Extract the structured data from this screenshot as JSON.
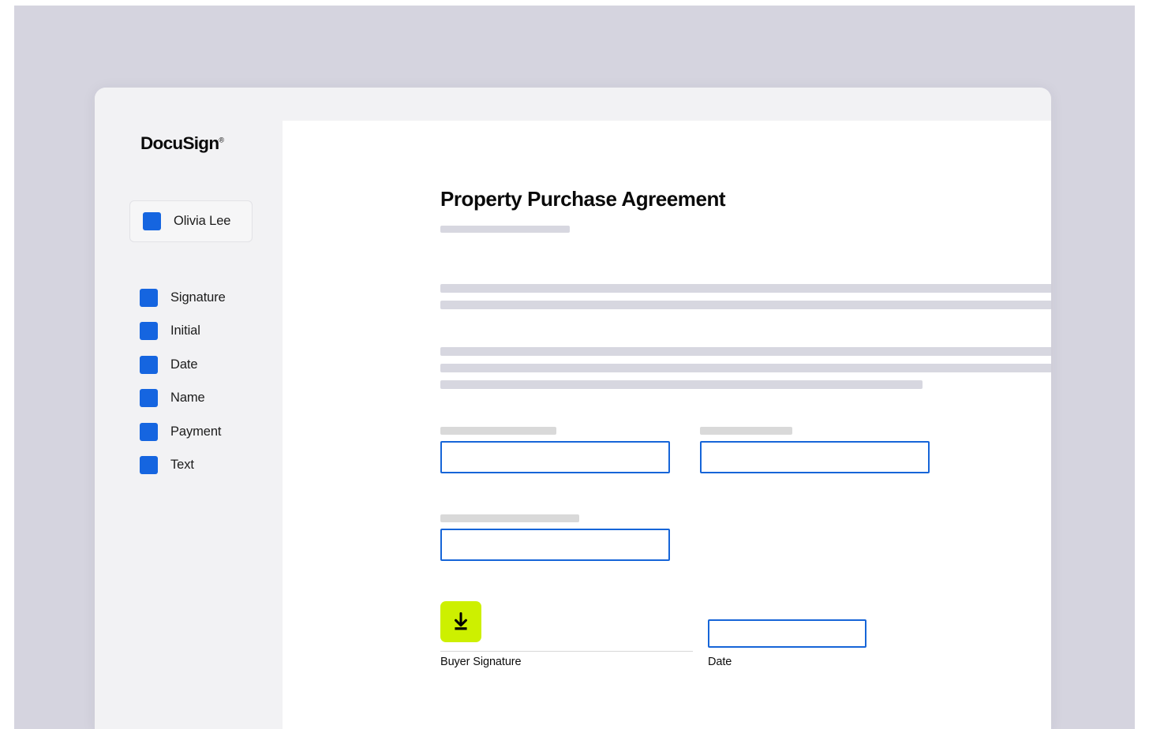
{
  "theme": {
    "desktop_bg": "#d5d4df",
    "window_bg": "#f2f2f4",
    "page_bg": "#ffffff",
    "accent_blue": "#1665d8",
    "recipient_swatch": "#1565e0",
    "signature_button_green": "#cdf000",
    "skeleton_gray": "#d7d7e0",
    "caption_gray": "#d9d9d9"
  },
  "sidebar": {
    "brand": "DocuSign",
    "brand_tm": "®",
    "recipient": {
      "name": "Olivia Lee",
      "swatch_color": "#1565e0"
    },
    "tools": [
      {
        "label": "Signature",
        "swatch_color": "#1565e0"
      },
      {
        "label": "Initial",
        "swatch_color": "#1565e0"
      },
      {
        "label": "Date",
        "swatch_color": "#1565e0"
      },
      {
        "label": "Name",
        "swatch_color": "#1565e0"
      },
      {
        "label": "Payment",
        "swatch_color": "#1565e0"
      },
      {
        "label": "Text",
        "swatch_color": "#1565e0"
      }
    ]
  },
  "document": {
    "title": "Property Purchase Agreement",
    "signature_caption": "Buyer Signature",
    "date_caption": "Date",
    "signature_button_icon": "download-icon"
  }
}
